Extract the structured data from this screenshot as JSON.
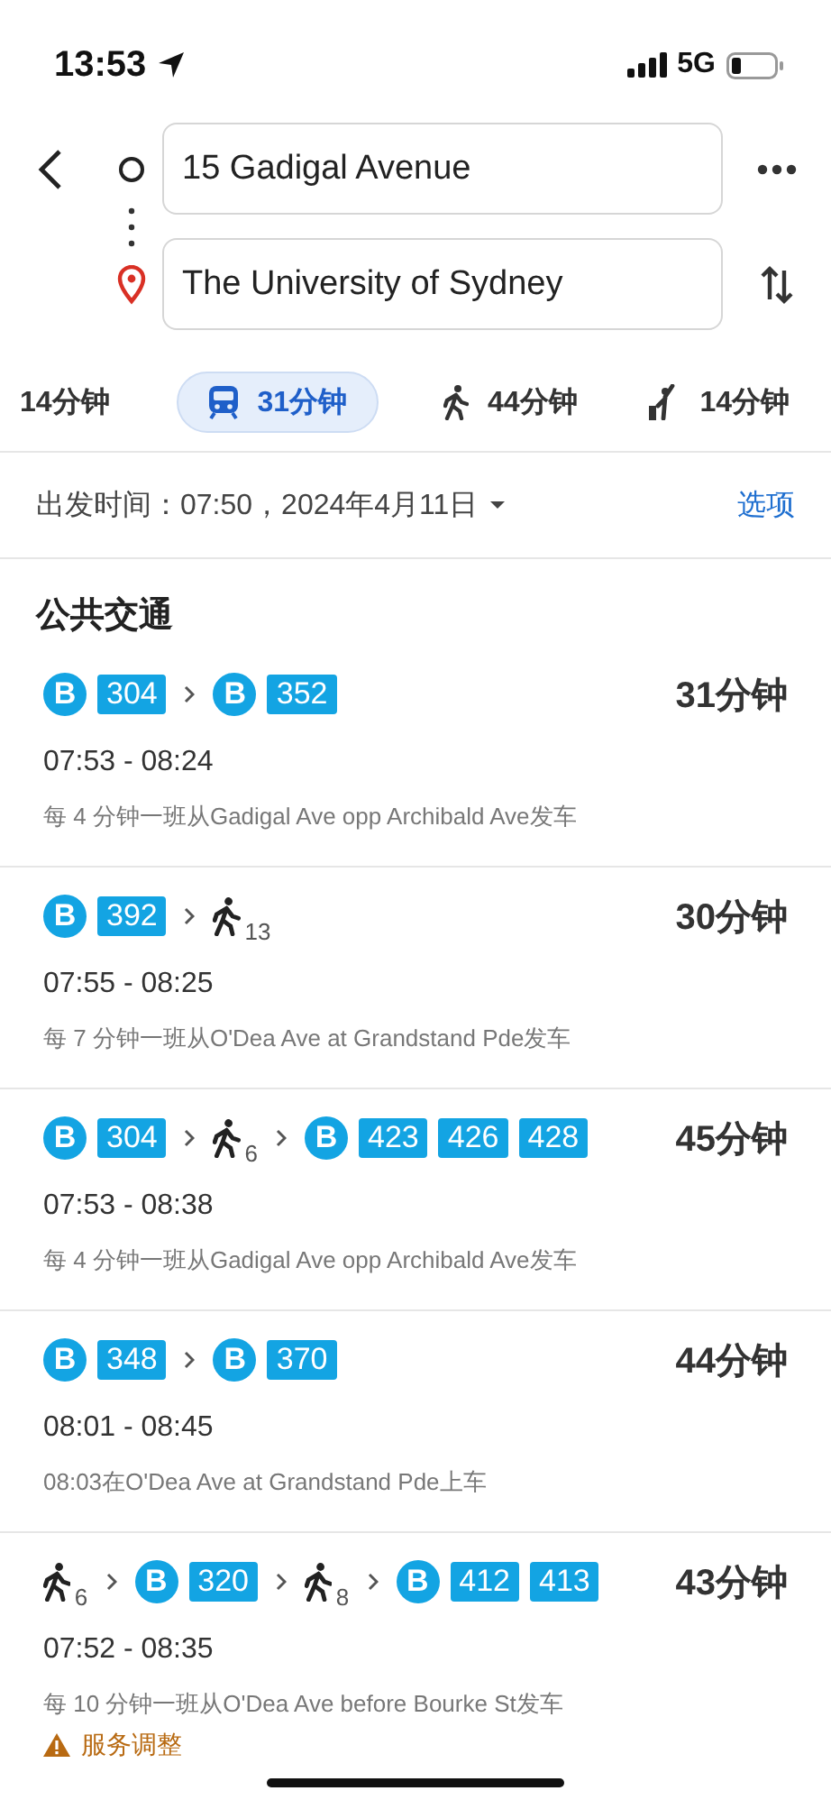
{
  "status_bar": {
    "time": "13:53",
    "network": "5G"
  },
  "trip": {
    "origin": {
      "value": "15 Gadigal Avenue"
    },
    "destination": {
      "value": "The University of Sydney"
    }
  },
  "modes": [
    {
      "kind": "car",
      "label": "14分钟",
      "selected": false
    },
    {
      "kind": "transit",
      "label": "31分钟",
      "selected": true
    },
    {
      "kind": "walk",
      "label": "44分钟",
      "selected": false
    },
    {
      "kind": "ride",
      "label": "14分钟",
      "selected": false
    }
  ],
  "departure": {
    "label": "出发时间：07:50，2024年4月11日",
    "options": "选项"
  },
  "section_title": "公共交通",
  "routes": [
    {
      "segments": [
        {
          "kind": "bus",
          "badge": "B",
          "lines": [
            "304"
          ]
        },
        {
          "kind": "bus",
          "badge": "B",
          "lines": [
            "352"
          ]
        }
      ],
      "duration": "31分钟",
      "times": "07:53 - 08:24",
      "note": "每 4 分钟一班从Gadigal Ave opp Archibald Ave发车"
    },
    {
      "segments": [
        {
          "kind": "bus",
          "badge": "B",
          "lines": [
            "392"
          ]
        },
        {
          "kind": "walk",
          "minutes": "13"
        }
      ],
      "duration": "30分钟",
      "times": "07:55 - 08:25",
      "note": "每 7 分钟一班从O'Dea Ave at Grandstand Pde发车"
    },
    {
      "segments": [
        {
          "kind": "bus",
          "badge": "B",
          "lines": [
            "304"
          ]
        },
        {
          "kind": "walk",
          "minutes": "6"
        },
        {
          "kind": "bus",
          "badge": "B",
          "lines": [
            "423",
            "426",
            "428"
          ]
        }
      ],
      "duration": "45分钟",
      "times": "07:53 - 08:38",
      "note": "每 4 分钟一班从Gadigal Ave opp Archibald Ave发车"
    },
    {
      "segments": [
        {
          "kind": "bus",
          "badge": "B",
          "lines": [
            "348"
          ]
        },
        {
          "kind": "bus",
          "badge": "B",
          "lines": [
            "370"
          ]
        }
      ],
      "duration": "44分钟",
      "times": "08:01 - 08:45",
      "note": "08:03在O'Dea Ave at Grandstand Pde上车"
    },
    {
      "segments": [
        {
          "kind": "walk",
          "minutes": "6"
        },
        {
          "kind": "bus",
          "badge": "B",
          "lines": [
            "320"
          ]
        },
        {
          "kind": "walk",
          "minutes": "8"
        },
        {
          "kind": "bus",
          "badge": "B",
          "lines": [
            "412",
            "413"
          ]
        }
      ],
      "duration": "43分钟",
      "times": "07:52 - 08:35",
      "note": "每 10 分钟一班从O'Dea Ave before Bourke St发车",
      "alert": "服务调整"
    }
  ]
}
